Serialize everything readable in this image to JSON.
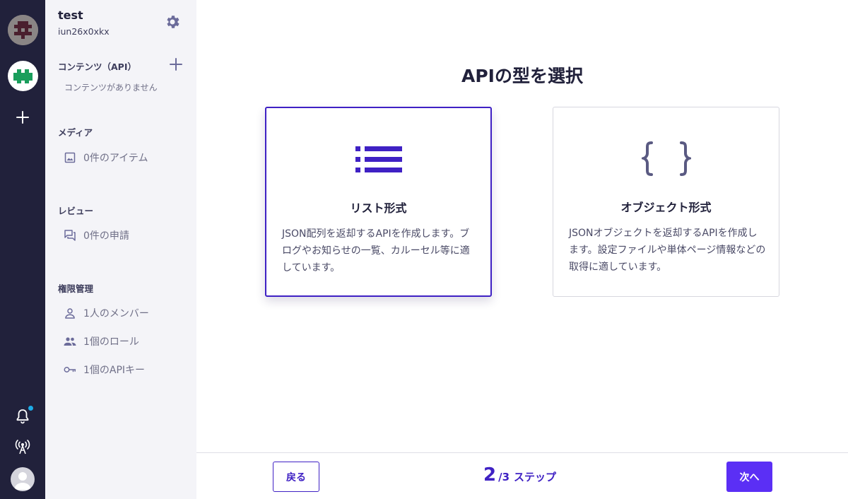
{
  "service": {
    "name": "test",
    "id": "iun26x0xkx"
  },
  "sidebar": {
    "contents": {
      "heading": "コンテンツ（API）",
      "empty": "コンテンツがありません"
    },
    "media": {
      "heading": "メディア",
      "items": [
        "0件のアイテム"
      ]
    },
    "review": {
      "heading": "レビュー",
      "items": [
        "0件の申請"
      ]
    },
    "permissions": {
      "heading": "権限管理",
      "members": "1人のメンバー",
      "roles": "1個のロール",
      "apikeys": "1個のAPIキー"
    }
  },
  "main": {
    "title": "APIの型を選択",
    "cards": [
      {
        "title": "リスト形式",
        "desc": "JSON配列を返却するAPIを作成します。ブログやお知らせの一覧、カルーセル等に適しています。",
        "selected": true,
        "icon": "list-icon"
      },
      {
        "title": "オブジェクト形式",
        "desc": "JSONオブジェクトを返却するAPIを作成します。設定ファイルや単体ページ情報などの取得に適しています。",
        "selected": false,
        "icon": "curly-braces-icon"
      }
    ]
  },
  "footer": {
    "back_label": "戻る",
    "next_label": "次へ",
    "step_current": "2",
    "step_total": "/3",
    "step_word": "ステップ"
  },
  "colors": {
    "rail": "#21213b",
    "sidebar": "#f4f4f8",
    "accent": "#3f21c4",
    "primary_button": "#5b2ff5",
    "notification_dot": "#1dabe6"
  }
}
